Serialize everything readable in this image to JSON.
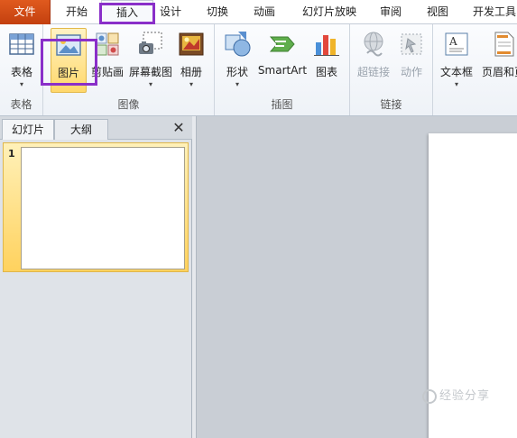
{
  "tabs": [
    {
      "label": "文件"
    },
    {
      "label": "开始"
    },
    {
      "label": "插入"
    },
    {
      "label": "设计"
    },
    {
      "label": "切换"
    },
    {
      "label": "动画"
    },
    {
      "label": "幻灯片放映"
    },
    {
      "label": "审阅"
    },
    {
      "label": "视图"
    },
    {
      "label": "开发工具"
    }
  ],
  "ribbon": {
    "groups": {
      "table": "表格",
      "images": "图像",
      "illustrations": "插图",
      "links": "链接"
    },
    "buttons": {
      "table": "表格",
      "picture": "图片",
      "clipart": "剪贴画",
      "screenshot": "屏幕截图",
      "album": "相册",
      "shapes": "形状",
      "smartart": "SmartArt",
      "chart": "图表",
      "hyperlink": "超链接",
      "action": "动作",
      "textbox": "文本框",
      "header_footer": "页眉和页"
    },
    "dropdown_glyph": "▾"
  },
  "pane": {
    "tab_slides": "幻灯片",
    "tab_outline": "大纲",
    "close_glyph": "✕",
    "slide_number": "1"
  },
  "watermark": "经验分享",
  "colors": {
    "file_tab": "#d04c16",
    "highlight": "#8a2fc9",
    "selection": "#ffd86b"
  }
}
